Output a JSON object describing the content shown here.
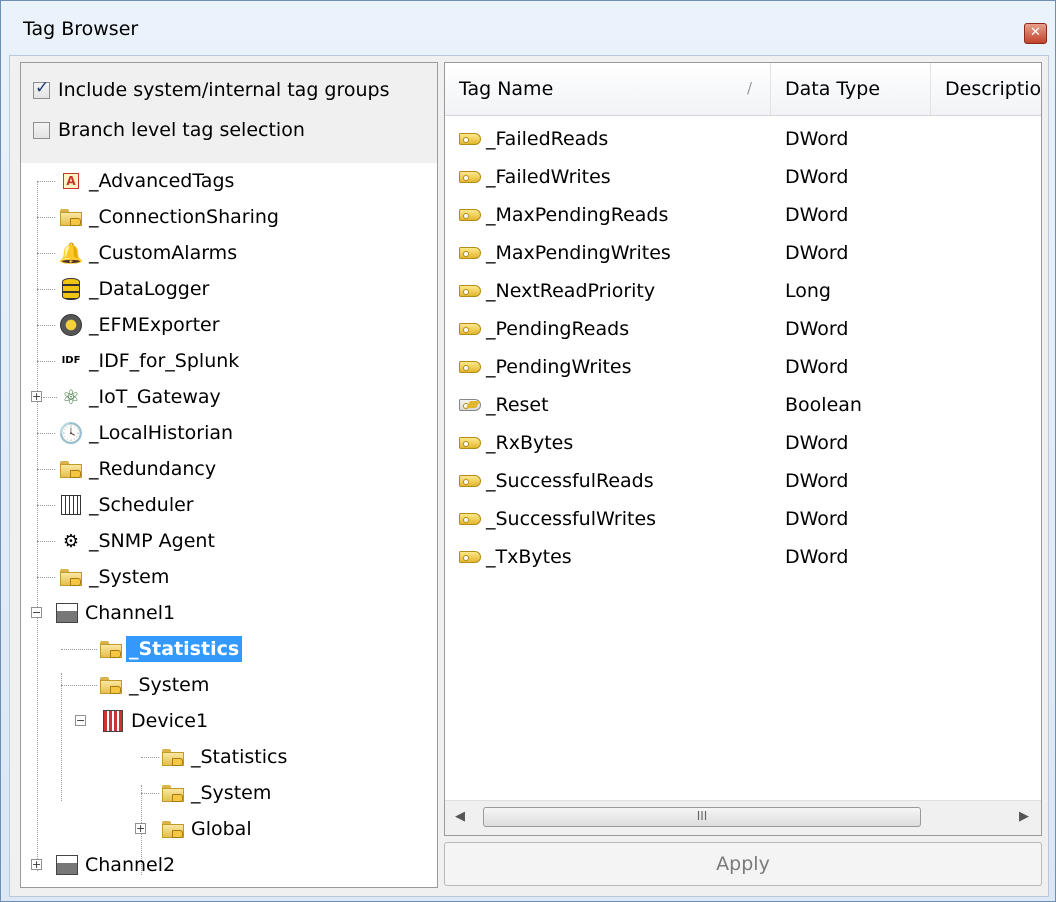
{
  "window": {
    "title": "Tag Browser",
    "close_label": "✕"
  },
  "options": {
    "include_system": {
      "label": "Include system/internal tag groups",
      "checked": true
    },
    "branch_level": {
      "label": "Branch level tag selection",
      "checked": false
    }
  },
  "tree": {
    "advanced_tags": "_AdvancedTags",
    "connection_sharing": "_ConnectionSharing",
    "custom_alarms": "_CustomAlarms",
    "data_logger": "_DataLogger",
    "efm_exporter": "_EFMExporter",
    "idf_for_splunk": "_IDF_for_Splunk",
    "iot_gateway": "_IoT_Gateway",
    "local_historian": "_LocalHistorian",
    "redundancy": "_Redundancy",
    "scheduler": "_Scheduler",
    "snmp_agent": "_SNMP Agent",
    "system": "_System",
    "channel1": "Channel1",
    "ch1_statistics": "_Statistics",
    "ch1_system": "_System",
    "device1": "Device1",
    "dev1_statistics": "_Statistics",
    "dev1_system": "_System",
    "dev1_global": "Global",
    "channel2": "Channel2",
    "icon_labels": {
      "advanced_tags": "A",
      "idf": "IDF"
    }
  },
  "table": {
    "columns": [
      "Tag Name",
      "Data Type",
      "Descriptio"
    ],
    "sort_indicator": "/",
    "rows": [
      {
        "name": "_FailedReads",
        "type": "DWord"
      },
      {
        "name": "_FailedWrites",
        "type": "DWord"
      },
      {
        "name": "_MaxPendingReads",
        "type": "DWord"
      },
      {
        "name": "_MaxPendingWrites",
        "type": "DWord"
      },
      {
        "name": "_NextReadPriority",
        "type": "Long"
      },
      {
        "name": "_PendingReads",
        "type": "DWord"
      },
      {
        "name": "_PendingWrites",
        "type": "DWord"
      },
      {
        "name": "_Reset",
        "type": "Boolean"
      },
      {
        "name": "_RxBytes",
        "type": "DWord"
      },
      {
        "name": "_SuccessfulReads",
        "type": "DWord"
      },
      {
        "name": "_SuccessfulWrites",
        "type": "DWord"
      },
      {
        "name": "_TxBytes",
        "type": "DWord"
      }
    ]
  },
  "scrollbar": {
    "left_arrow": "◀",
    "right_arrow": "▶",
    "thumb_grip": "III"
  },
  "apply_label": "Apply",
  "colors": {
    "selection": "#3399ff",
    "titlebar": "#dbe7f5",
    "tag_icon": "#f5c742"
  }
}
